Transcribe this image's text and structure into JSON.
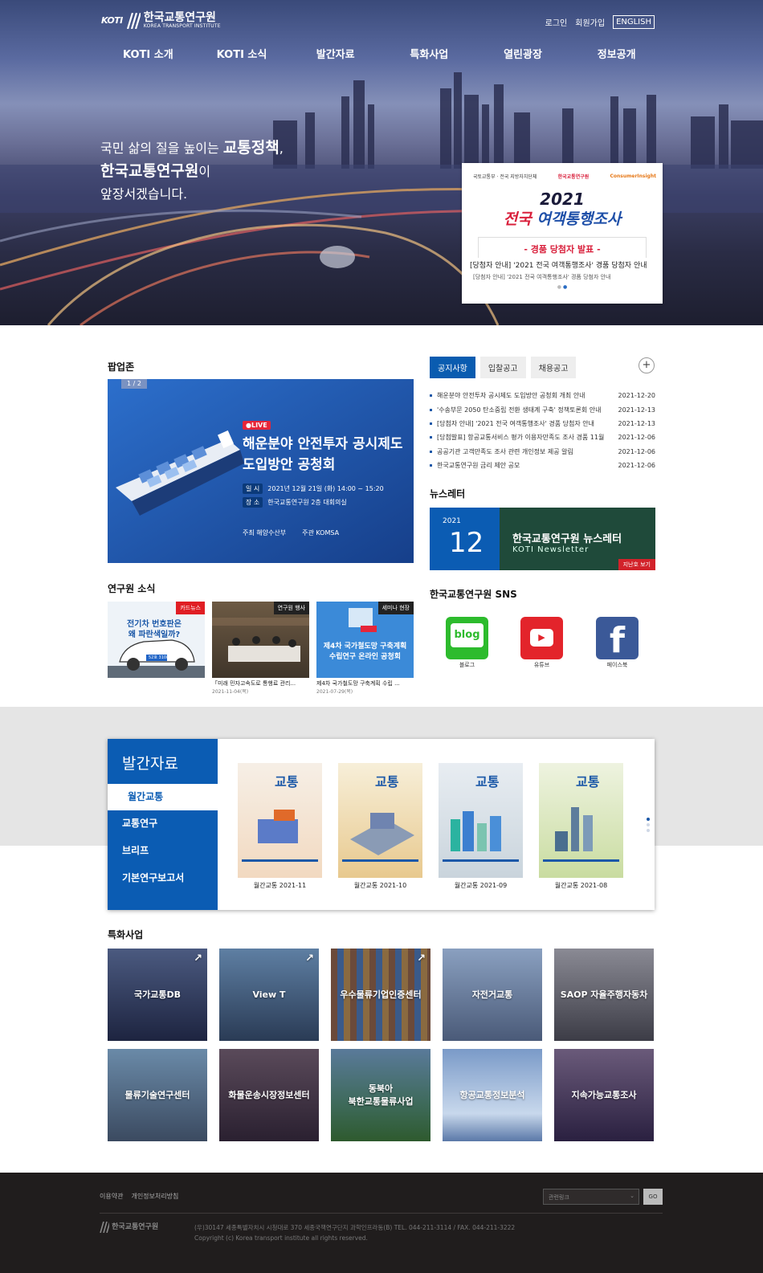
{
  "header": {
    "logo_mark": "KOTI",
    "logo_kor": "한국교통연구원",
    "logo_eng": "KOREA TRANSPORT INSTITUTE",
    "login": "로그인",
    "signup": "회원가입",
    "english": "ENGLISH",
    "nav": [
      "KOTI 소개",
      "KOTI 소식",
      "발간자료",
      "특화사업",
      "열린광장",
      "정보공개"
    ]
  },
  "hero": {
    "line1_a": "국민 삶의 질을 높이는 ",
    "line1_b": "교통정책",
    "line1_c": ",",
    "line2_a": "한국교통연구원",
    "line2_b": "이",
    "line3": "앞장서겠습니다."
  },
  "hero_popup": {
    "logo_left": "국토교통부 · 전국 지방자치단체",
    "logo_mid": "한국교통연구원",
    "logo_right": "ConsumerInsight",
    "year": "2021",
    "title_a": "전국 ",
    "title_b": "여객통행조사",
    "badge": "- 경품 당첨자 발표 -",
    "caption": "[당첨자 안내] '2021 전국 여객통행조사' 경품 당첨자 안내",
    "caption_small": "[당첨자 안내] '2021 전국 여객통행조사' 경품 당첨자 안내",
    "dots": "●"
  },
  "popupzone": {
    "title": "팝업존",
    "counter": "1 / 2",
    "live": "●LIVE",
    "headline_1": "해운분야 안전투자 공시제도",
    "headline_2": "도입방안 공청회",
    "date_key": "일 시",
    "date_val": "2021년 12월 21일 (화) 14:00 ~ 15:20",
    "place_key": "장 소",
    "place_val": "한국교통연구원 2층 대회의실",
    "host_label": "주최",
    "host": "해양수산부",
    "org_label": "주관",
    "org": "KOMSA"
  },
  "notice": {
    "tabs": [
      "공지사항",
      "입찰공고",
      "채용공고"
    ],
    "more": "+",
    "items": [
      {
        "title": "해운분야 안전투자 공시제도 도입방안 공청회 개최 안내",
        "date": "2021-12-20"
      },
      {
        "title": "'수송부문 2050 탄소중립 전환 생태계 구축' 정책토론회 안내",
        "date": "2021-12-13"
      },
      {
        "title": "[당첨자 안내] '2021 전국 여객통행조사' 경품 당첨자 안내",
        "date": "2021-12-13"
      },
      {
        "title": "[당첨발표] 항공교통서비스 평가 이용자만족도 조사 경품 11월 ...",
        "date": "2021-12-06"
      },
      {
        "title": "공공기관 고객만족도 조사 관련 개인정보 제공 알림",
        "date": "2021-12-06"
      },
      {
        "title": "한국교통연구원 금리 제안 공모",
        "date": "2021-12-06"
      }
    ]
  },
  "newsletter": {
    "title": "뉴스레터",
    "year": "2021",
    "month": "12",
    "name": "한국교통연구원 뉴스레터",
    "sub": "KOTI Newsletter",
    "past": "지난호 보기"
  },
  "news": {
    "title": "연구원 소식",
    "cards": [
      {
        "tag": "카드뉴스",
        "tag_color": "#e01e24",
        "img_text": "전기차 번호판은 왜 파란색일까?",
        "plate": "52호 3108",
        "caption": "",
        "date": ""
      },
      {
        "tag": "연구원 행사",
        "tag_color": "#222222",
        "caption": "「미래 민자고속도로 통행료 관리...",
        "date": "2021-11-04(목)"
      },
      {
        "tag": "세미나 현장",
        "tag_color": "#222222",
        "img_text": "제4차 국가철도망 구축계획 수립연구 온라인 공청회",
        "caption": "제4차 국가철도망 구축계획 수립 ...",
        "date": "2021-07-29(목)"
      }
    ]
  },
  "sns": {
    "title": "한국교통연구원 SNS",
    "items": [
      {
        "label": "블로그",
        "icon": "blog-icon",
        "glyph": "blog"
      },
      {
        "label": "유튜브",
        "icon": "youtube-icon",
        "glyph": "▶"
      },
      {
        "label": "페이스북",
        "icon": "facebook-icon",
        "glyph": "f"
      }
    ]
  },
  "publications": {
    "title": "발간자료",
    "menu": [
      "월간교통",
      "교통연구",
      "브리프",
      "기본연구보고서"
    ],
    "books": [
      {
        "label": "월간교통 2021-11",
        "cover": "교통"
      },
      {
        "label": "월간교통 2021-10",
        "cover": "교통"
      },
      {
        "label": "월간교통 2021-09",
        "cover": "교통"
      },
      {
        "label": "월간교통 2021-08",
        "cover": "교통"
      }
    ]
  },
  "special": {
    "title": "특화사업",
    "tiles": [
      {
        "label": "국가교통DB",
        "ext": "↗"
      },
      {
        "label": "View T",
        "ext": "↗"
      },
      {
        "label": "우수물류기업인증센터",
        "ext": "↗"
      },
      {
        "label": "자전거교통",
        "ext": ""
      },
      {
        "label": "SAOP 자율주행자동차",
        "ext": ""
      },
      {
        "label": "물류기술연구센터",
        "ext": ""
      },
      {
        "label": "화물운송시장정보센터",
        "ext": ""
      },
      {
        "label": "동북아\n북한교통물류사업",
        "ext": ""
      },
      {
        "label": "항공교통정보분석",
        "ext": ""
      },
      {
        "label": "지속가능교통조사",
        "ext": ""
      }
    ]
  },
  "footer": {
    "terms": "이용약관",
    "privacy": "개인정보처리방침",
    "related_select": "관련링크",
    "go": "GO",
    "logo": "한국교통연구원",
    "address": "(우)30147 세종특별자치시 시청대로 370 세종국책연구단지 과학인프라동(B) TEL. 044-211-3114 / FAX. 044-211-3222",
    "copyright": "Copyright (c) Korea transport institute all rights reserved."
  }
}
